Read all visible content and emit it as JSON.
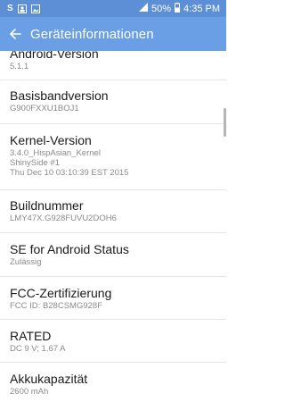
{
  "status_bar": {
    "left_icons": [
      "s-icon",
      "person-icon",
      "image-icon"
    ],
    "battery": "50%",
    "time": "4:35 PM"
  },
  "action_bar": {
    "title": "Geräteinformationen"
  },
  "items": [
    {
      "title": "Android-Version",
      "value": "5.1.1"
    },
    {
      "title": "Basisbandversion",
      "value": "G900FXXU1BOJ1"
    },
    {
      "title": "Kernel-Version",
      "value": "3.4.0_HispAsian_Kernel\nShinySide #1\nThu Dec 10 03:10:39 EST 2015"
    },
    {
      "title": "Buildnummer",
      "value": "LMY47X.G928FUVU2DOH6"
    },
    {
      "title": "SE for Android Status",
      "value": "Zulässig"
    },
    {
      "title": "FCC-Zertifizierung",
      "value": "FCC ID: B28CSMG928F"
    },
    {
      "title": "RATED",
      "value": "DC 9 V; 1.67 A"
    },
    {
      "title": "Akkukapazität",
      "value": "2600 mAh"
    }
  ]
}
